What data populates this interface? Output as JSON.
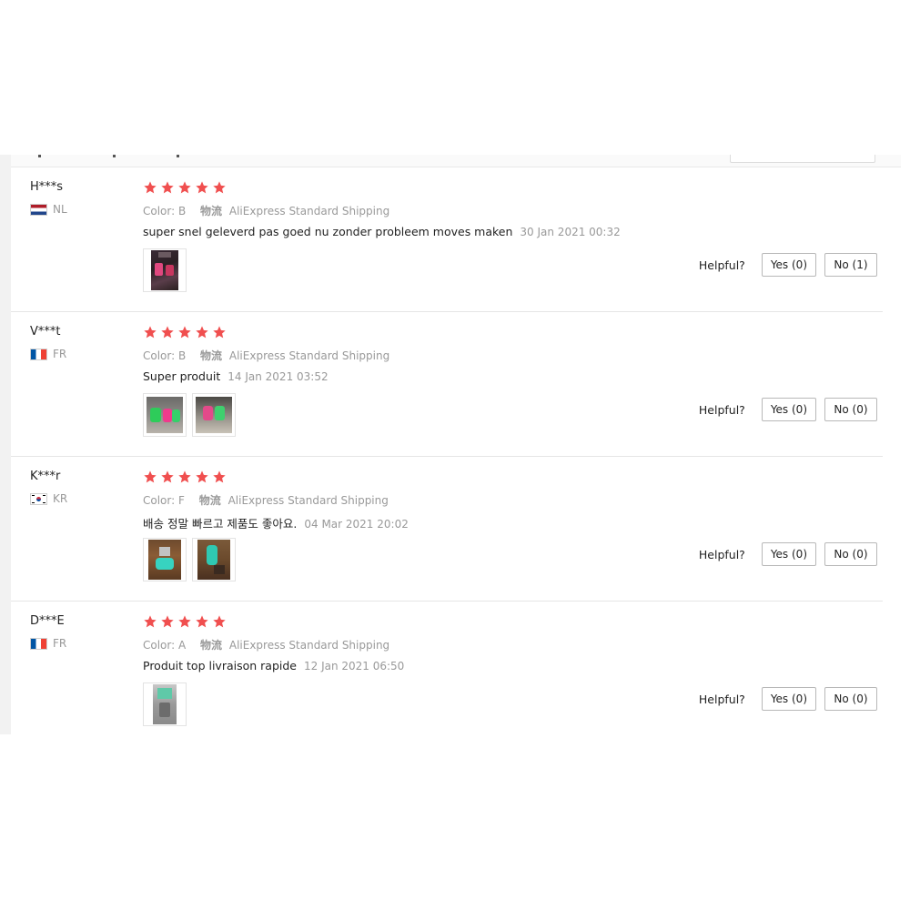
{
  "reviews": [
    {
      "user": "H***s",
      "country_code": "NL",
      "flag_icon": "nl-flag-icon",
      "rating": 5,
      "color_label": "Color: B",
      "shipping_prefix": "物流",
      "shipping": "AliExpress Standard Shipping",
      "text": "super snel geleverd pas goed nu zonder probleem moves maken",
      "date": "30 Jan 2021 00:32",
      "photos": [
        "pink-joycon-photo"
      ],
      "helpful_label": "Helpful?",
      "yes_label": "Yes (0)",
      "no_label": "No (1)"
    },
    {
      "user": "V***t",
      "country_code": "FR",
      "flag_icon": "fr-flag-icon",
      "rating": 5,
      "color_label": "Color: B",
      "shipping_prefix": "物流",
      "shipping": "AliExpress Standard Shipping",
      "text": "Super produit",
      "date": "14 Jan 2021 03:52",
      "photos": [
        "green-pink-joycon-photo",
        "joycon-photo"
      ],
      "helpful_label": "Helpful?",
      "yes_label": "Yes (0)",
      "no_label": "No (0)"
    },
    {
      "user": "K***r",
      "country_code": "KR",
      "flag_icon": "kr-flag-icon",
      "rating": 5,
      "color_label": "Color: F",
      "shipping_prefix": "物流",
      "shipping": "AliExpress Standard Shipping",
      "text": "배송 정말 빠르고 제품도 좋아요.",
      "date": "04 Mar 2021 20:02",
      "photos": [
        "teal-joycon-photo",
        "teal-joycon-photo"
      ],
      "helpful_label": "Helpful?",
      "yes_label": "Yes (0)",
      "no_label": "No (0)"
    },
    {
      "user": "D***E",
      "country_code": "FR",
      "flag_icon": "fr-flag-icon",
      "rating": 5,
      "color_label": "Color: A",
      "shipping_prefix": "物流",
      "shipping": "AliExpress Standard Shipping",
      "text": "Produit top livraison rapide",
      "date": "12 Jan 2021 06:50",
      "photos": [
        "packaged-joycon-photo"
      ],
      "helpful_label": "Helpful?",
      "yes_label": "Yes (0)",
      "no_label": "No (0)"
    }
  ],
  "colors": {
    "star": "#f04f4f",
    "muted_text": "#999999",
    "divider": "#e5e5e5"
  }
}
